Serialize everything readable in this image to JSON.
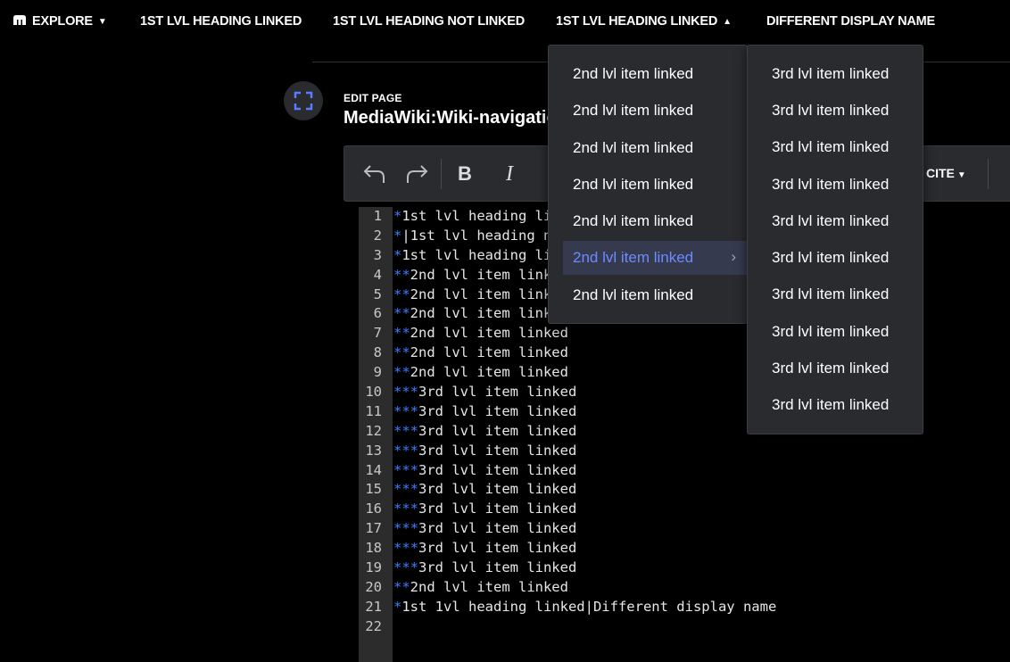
{
  "nav": {
    "explore": "EXPLORE",
    "items": [
      "1ST LVL HEADING LINKED",
      "1ST LVL HEADING NOT LINKED",
      "1ST LVL HEADING LINKED",
      "DIFFERENT DISPLAY NAME"
    ]
  },
  "editor": {
    "edit_label": "EDIT PAGE",
    "page_title": "MediaWiki:Wiki-navigation",
    "cite_label": "CITE"
  },
  "code_lines": [
    {
      "n": "1",
      "mk": "*",
      "t": "1st lvl heading linked"
    },
    {
      "n": "2",
      "mk": "*",
      "t": "|1st lvl heading not linked"
    },
    {
      "n": "3",
      "mk": "*",
      "t": "1st lvl heading linked"
    },
    {
      "n": "4",
      "mk": "**",
      "t": "2nd lvl item linked"
    },
    {
      "n": "5",
      "mk": "**",
      "t": "2nd lvl item linked"
    },
    {
      "n": "6",
      "mk": "**",
      "t": "2nd lvl item linked"
    },
    {
      "n": "7",
      "mk": "**",
      "t": "2nd lvl item linked"
    },
    {
      "n": "8",
      "mk": "**",
      "t": "2nd lvl item linked"
    },
    {
      "n": "9",
      "mk": "**",
      "t": "2nd lvl item linked"
    },
    {
      "n": "10",
      "mk": "***",
      "t": "3rd lvl item linked"
    },
    {
      "n": "11",
      "mk": "***",
      "t": "3rd lvl item linked"
    },
    {
      "n": "12",
      "mk": "***",
      "t": "3rd lvl item linked"
    },
    {
      "n": "13",
      "mk": "***",
      "t": "3rd lvl item linked"
    },
    {
      "n": "14",
      "mk": "***",
      "t": "3rd lvl item linked"
    },
    {
      "n": "15",
      "mk": "***",
      "t": "3rd lvl item linked"
    },
    {
      "n": "16",
      "mk": "***",
      "t": "3rd lvl item linked"
    },
    {
      "n": "17",
      "mk": "***",
      "t": "3rd lvl item linked"
    },
    {
      "n": "18",
      "mk": "***",
      "t": "3rd lvl item linked"
    },
    {
      "n": "19",
      "mk": "***",
      "t": "3rd lvl item linked"
    },
    {
      "n": "20",
      "mk": "**",
      "t": "2nd lvl item linked"
    },
    {
      "n": "21",
      "mk": "*",
      "t": "1st 1vl heading linked|Different display name"
    },
    {
      "n": "22",
      "mk": "",
      "t": ""
    }
  ],
  "dropdown_2nd": [
    "2nd lvl item linked",
    "2nd lvl item linked",
    "2nd lvl item linked",
    "2nd lvl item linked",
    "2nd lvl item linked",
    "2nd lvl item linked",
    "2nd lvl item linked"
  ],
  "dropdown_3rd": [
    "3rd lvl item linked",
    "3rd lvl item linked",
    "3rd lvl item linked",
    "3rd lvl item linked",
    "3rd lvl item linked",
    "3rd lvl item linked",
    "3rd lvl item linked",
    "3rd lvl item linked",
    "3rd lvl item linked",
    "3rd lvl item linked"
  ],
  "colors": {
    "background": "#000000",
    "panel": "#2a2b2f",
    "accent": "#6b8cff",
    "markup": "#3c7cff"
  }
}
